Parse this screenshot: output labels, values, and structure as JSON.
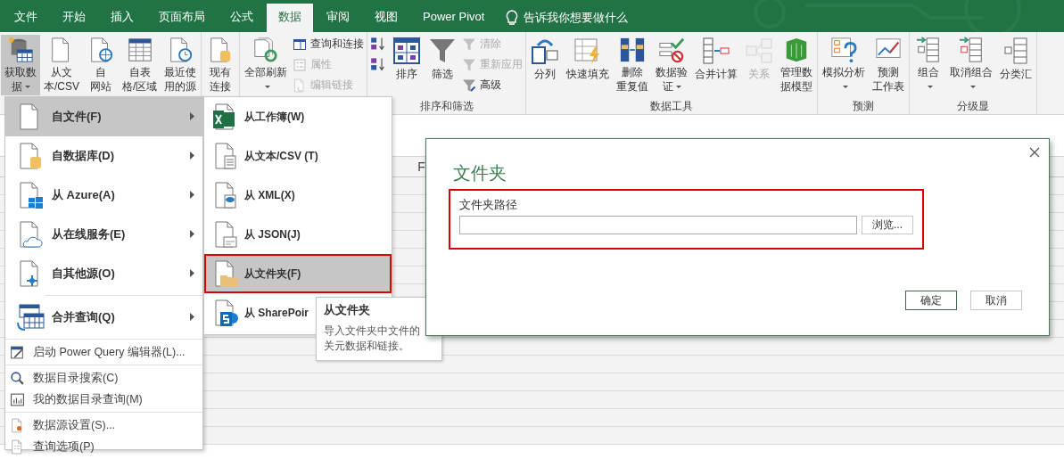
{
  "tabs": [
    {
      "label": "文件",
      "selected": false
    },
    {
      "label": "开始",
      "selected": false
    },
    {
      "label": "插入",
      "selected": false
    },
    {
      "label": "页面布局",
      "selected": false
    },
    {
      "label": "公式",
      "selected": false
    },
    {
      "label": "数据",
      "selected": true
    },
    {
      "label": "审阅",
      "selected": false
    },
    {
      "label": "视图",
      "selected": false
    },
    {
      "label": "Power Pivot",
      "selected": false
    }
  ],
  "tell_me": {
    "label": "告诉我你想要做什么"
  },
  "ribbon": {
    "groups": [
      {
        "items": [
          {
            "kind": "large",
            "lines": [
              "获取数",
              "据"
            ],
            "dropdown": true,
            "disabled": false,
            "pressed": true
          },
          {
            "kind": "large",
            "lines": [
              "从文",
              "本/CSV"
            ],
            "dropdown": false,
            "disabled": false,
            "pressed": false
          },
          {
            "kind": "large",
            "lines": [
              "自",
              "网站"
            ],
            "dropdown": false,
            "disabled": false,
            "pressed": false
          },
          {
            "kind": "large",
            "lines": [
              "自表",
              "格/区域"
            ],
            "dropdown": false,
            "disabled": false,
            "pressed": false
          },
          {
            "kind": "large",
            "lines": [
              "最近使",
              "用的源"
            ],
            "dropdown": false,
            "disabled": false,
            "pressed": false
          }
        ]
      },
      {
        "items": [
          {
            "kind": "large",
            "lines": [
              "现有",
              "连接"
            ],
            "dropdown": false,
            "disabled": false,
            "pressed": false
          }
        ]
      },
      {
        "items": [
          {
            "kind": "large",
            "lines": [
              "全部刷新"
            ],
            "dropdown": true,
            "disabled": false,
            "pressed": false
          },
          {
            "kind": "stack",
            "items": [
              {
                "label": "查询和连接",
                "disabled": false
              },
              {
                "label": "属性",
                "disabled": true
              },
              {
                "label": "编辑链接",
                "disabled": true
              }
            ]
          }
        ]
      },
      {
        "label": "排序和筛选",
        "items": [
          {
            "kind": "stack",
            "items": [
              {
                "disabled": false
              },
              {
                "disabled": false
              }
            ]
          },
          {
            "kind": "large",
            "lines": [
              "排序"
            ],
            "dropdown": false,
            "disabled": false,
            "pressed": false
          },
          {
            "kind": "large",
            "lines": [
              "筛选"
            ],
            "dropdown": false,
            "disabled": false,
            "pressed": false
          },
          {
            "kind": "stack",
            "items": [
              {
                "label": "清除",
                "disabled": true
              },
              {
                "label": "重新应用",
                "disabled": true
              },
              {
                "label": "高级",
                "disabled": false
              }
            ]
          }
        ]
      },
      {
        "label": "数据工具",
        "items": [
          {
            "kind": "large",
            "lines": [
              "分列"
            ],
            "dropdown": false,
            "disabled": false,
            "pressed": false
          },
          {
            "kind": "large",
            "lines": [
              "快速填充"
            ],
            "dropdown": false,
            "disabled": false,
            "pressed": false
          },
          {
            "kind": "large",
            "lines": [
              "删除",
              "重复值"
            ],
            "dropdown": false,
            "disabled": false,
            "pressed": false
          },
          {
            "kind": "large",
            "lines": [
              "数据验",
              "证"
            ],
            "dropdown": true,
            "disabled": false,
            "pressed": false
          },
          {
            "kind": "large",
            "lines": [
              "合并计算"
            ],
            "dropdown": false,
            "disabled": false,
            "pressed": false
          },
          {
            "kind": "large",
            "lines": [
              "关系"
            ],
            "dropdown": false,
            "disabled": true,
            "pressed": false
          },
          {
            "kind": "large",
            "lines": [
              "管理数",
              "据模型"
            ],
            "dropdown": false,
            "disabled": false,
            "pressed": false
          }
        ]
      },
      {
        "label": "预测",
        "items": [
          {
            "kind": "large",
            "lines": [
              "模拟分析"
            ],
            "dropdown": true,
            "disabled": false,
            "pressed": false
          },
          {
            "kind": "large",
            "lines": [
              "预测",
              "工作表"
            ],
            "dropdown": false,
            "disabled": false,
            "pressed": false
          }
        ]
      },
      {
        "label": "分级显",
        "items": [
          {
            "kind": "large",
            "lines": [
              "组合"
            ],
            "dropdown": true,
            "disabled": false,
            "pressed": false
          },
          {
            "kind": "large",
            "lines": [
              "取消组合"
            ],
            "dropdown": true,
            "disabled": false,
            "pressed": false
          },
          {
            "kind": "large",
            "lines": [
              "分类汇"
            ],
            "dropdown": false,
            "disabled": false,
            "pressed": false
          }
        ]
      }
    ]
  },
  "sheet": {
    "column_headers": [
      {
        "label": "F"
      }
    ]
  },
  "menu": {
    "sections": [
      [
        {
          "kind": "submenu",
          "label": "自文件(F)",
          "selected": true
        },
        {
          "kind": "submenu",
          "label": "自数据库(D)",
          "selected": false
        },
        {
          "kind": "submenu",
          "label": "从 Azure(A)",
          "selected": false
        },
        {
          "kind": "submenu",
          "label": "从在线服务(E)",
          "selected": false
        },
        {
          "kind": "submenu",
          "label": "自其他源(O)",
          "selected": false
        }
      ],
      [
        {
          "kind": "submenu",
          "label": "合并查询(Q)",
          "selected": false
        }
      ],
      [
        {
          "kind": "command",
          "label": "启动 Power Query 编辑器(L)...",
          "selected": false
        }
      ],
      [
        {
          "kind": "command",
          "label": "数据目录搜索(C)",
          "selected": false
        },
        {
          "kind": "command",
          "label": "我的数据目录查询(M)",
          "selected": false
        }
      ],
      [
        {
          "kind": "command",
          "label": "数据源设置(S)...",
          "selected": false
        },
        {
          "kind": "command",
          "label": "查询选项(P)",
          "selected": false
        }
      ]
    ]
  },
  "submenu": {
    "items": [
      {
        "label": "从工作簿(W)",
        "selected": false,
        "outlined": false
      },
      {
        "label": "从文本/CSV (T)",
        "selected": false,
        "outlined": false
      },
      {
        "label": "从 XML(X)",
        "selected": false,
        "outlined": false
      },
      {
        "label": "从 JSON(J)",
        "selected": false,
        "outlined": false
      },
      {
        "label": "从文件夹(F)",
        "selected": true,
        "outlined": true
      },
      {
        "label": "从 SharePoir",
        "selected": false,
        "outlined": false
      }
    ]
  },
  "tooltip": {
    "title": "从文件夹",
    "lines": [
      "导入文件夹中文件的",
      "关元数据和链接。"
    ]
  },
  "dialog": {
    "title": "文件夹",
    "field": {
      "label": "文件夹路径",
      "outlined": true
    },
    "browse": "浏览...",
    "buttons": [
      {
        "label": "确定",
        "default": true
      },
      {
        "label": "取消",
        "default": false
      }
    ]
  }
}
